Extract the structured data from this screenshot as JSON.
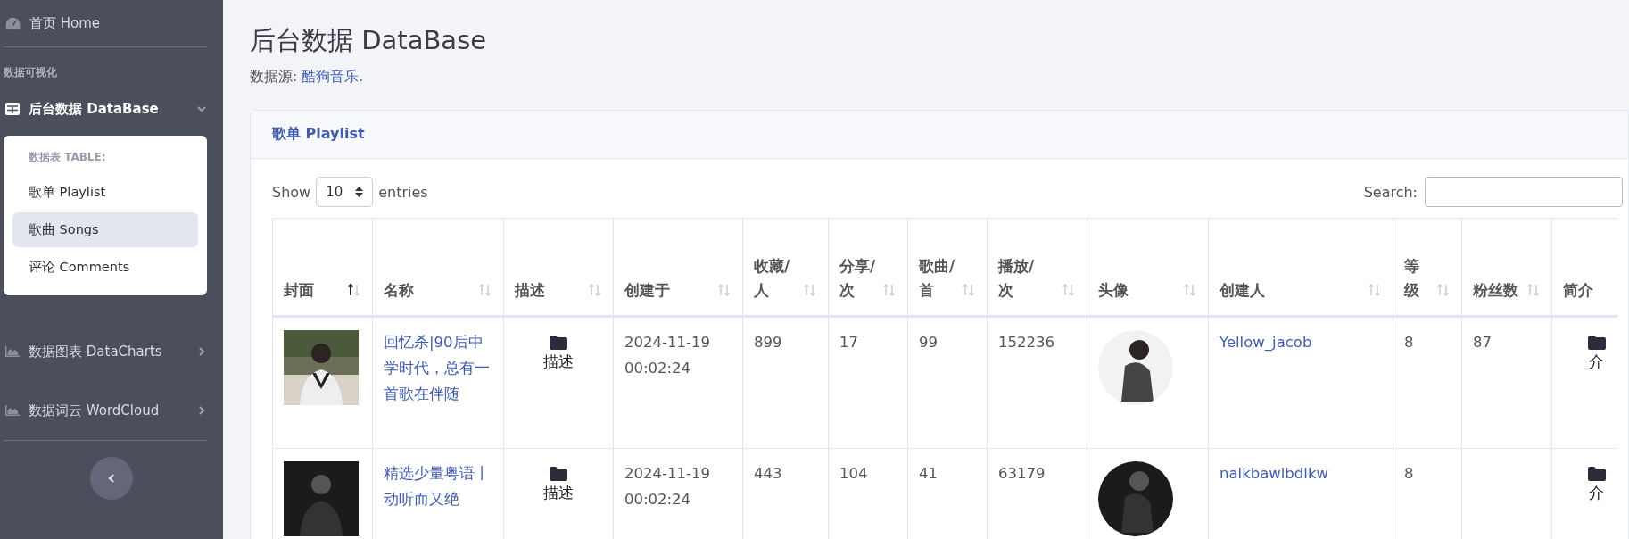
{
  "sidebar": {
    "home": {
      "label": "首页 Home"
    },
    "heading": "数据可视化",
    "groups": [
      {
        "label": "后台数据 DataBase",
        "expanded": true,
        "panel": {
          "title": "数据表 TABLE:",
          "items": [
            {
              "label": "歌单 Playlist",
              "selected": false
            },
            {
              "label": "歌曲 Songs",
              "selected": true
            },
            {
              "label": "评论 Comments",
              "selected": false
            }
          ]
        }
      },
      {
        "label": "数据图表 DataCharts",
        "expanded": false
      },
      {
        "label": "数据词云 WordCloud",
        "expanded": false
      }
    ]
  },
  "page": {
    "title": "后台数据 DataBase",
    "source_label": "数据源:",
    "source_link": "酷狗音乐",
    "source_end": "."
  },
  "card": {
    "title": "歌单 Playlist",
    "length": {
      "before": "Show",
      "value": "10",
      "after": "entries"
    },
    "search": {
      "label": "Search:"
    },
    "table": {
      "columns": [
        {
          "label": "封面",
          "sorted": true
        },
        {
          "label": "名称",
          "sorted": false
        },
        {
          "label": "描述",
          "sorted": false
        },
        {
          "label": "创建于",
          "sorted": false
        },
        {
          "label": "收藏/人",
          "sorted": false
        },
        {
          "label": "分享/次",
          "sorted": false
        },
        {
          "label": "歌曲/首",
          "sorted": false
        },
        {
          "label": "播放/次",
          "sorted": false
        },
        {
          "label": "头像",
          "sorted": false
        },
        {
          "label": "创建人",
          "sorted": false
        },
        {
          "label": "等级",
          "sorted": false
        },
        {
          "label": "粉丝数",
          "sorted": false
        },
        {
          "label": "简介"
        }
      ],
      "rows": [
        {
          "name": "回忆杀|90后中学时代，总有一首歌在伴随",
          "desc": "描述",
          "created": "2024-11-19 00:02:24",
          "favorites": "899",
          "shares": "17",
          "songs": "99",
          "plays": "152236",
          "creator": "Yellow_jacob",
          "level_text": "8",
          "fans": "87",
          "intro": "介"
        },
        {
          "name": "精选少量粤语丨动听而又绝",
          "desc": "描述",
          "created": "2024-11-19 00:02:24",
          "favorites": "443",
          "shares": "104",
          "songs": "41",
          "plays": "63179",
          "creator": "nalkbawlbdlkw",
          "level_text": "8",
          "intro": "介"
        }
      ]
    }
  }
}
